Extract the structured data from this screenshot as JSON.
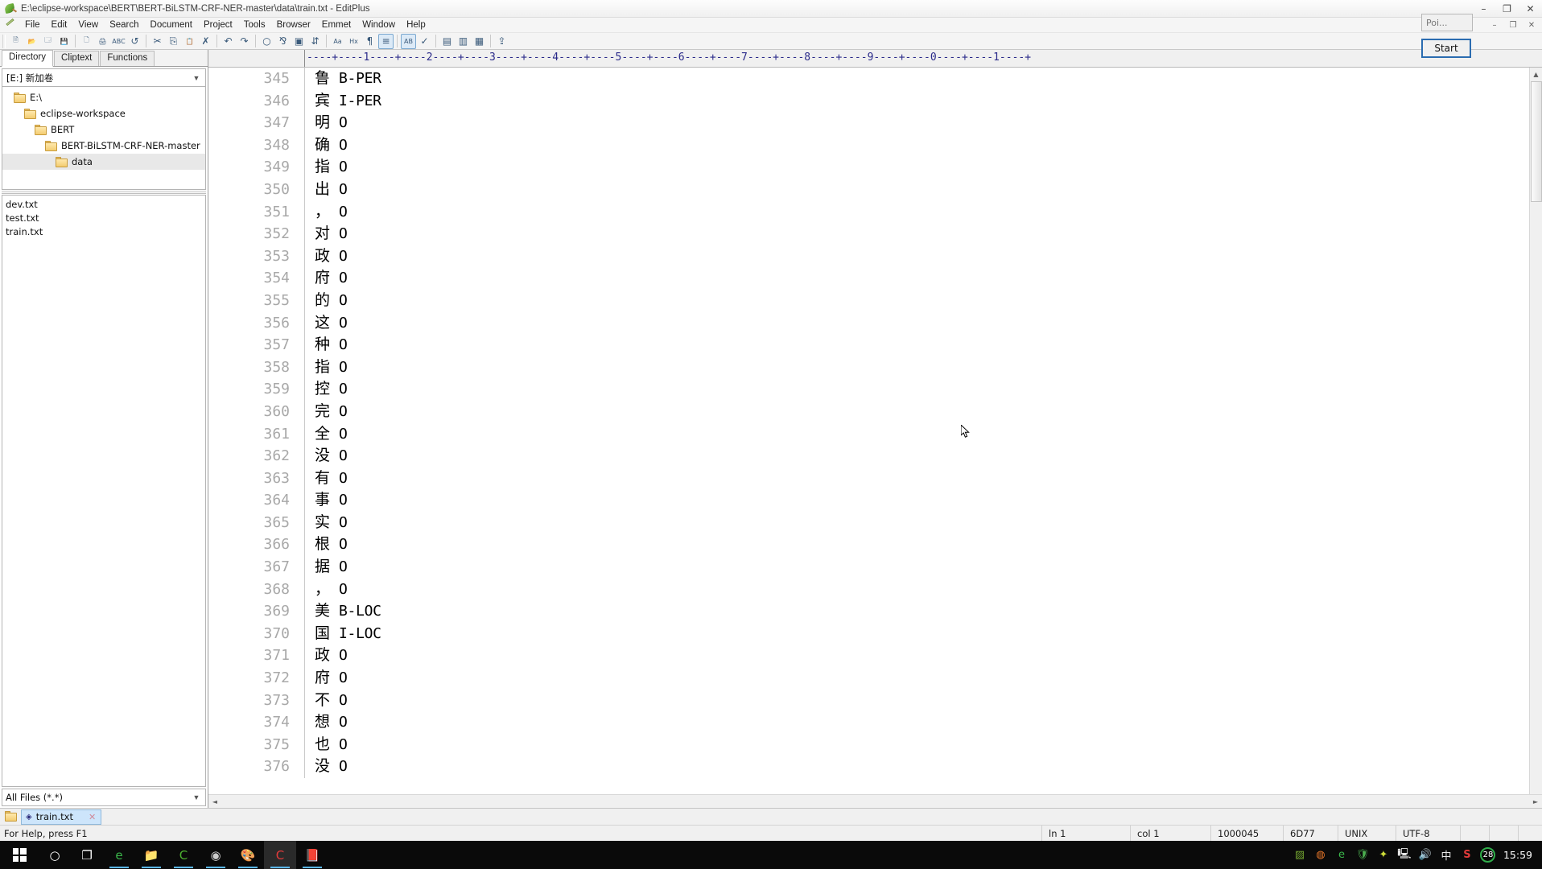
{
  "window": {
    "title": "E:\\eclipse-workspace\\BERT\\BERT-BiLSTM-CRF-NER-master\\data\\train.txt - EditPlus",
    "minimize": "–",
    "maximize": "❐",
    "close": "✕",
    "inner_minimize": "–",
    "inner_maximize": "❐",
    "inner_close": "✕"
  },
  "menu": {
    "items": [
      "File",
      "Edit",
      "View",
      "Search",
      "Document",
      "Project",
      "Tools",
      "Browser",
      "Emmet",
      "Window",
      "Help"
    ]
  },
  "toolbar": {
    "buttons": [
      {
        "name": "new-file",
        "glyph": "🗎"
      },
      {
        "name": "open-file",
        "glyph": "📂"
      },
      {
        "name": "close-file",
        "glyph": "🗔"
      },
      {
        "name": "save-file",
        "glyph": "💾"
      },
      {
        "name": "print-preview",
        "glyph": "🗋"
      },
      {
        "name": "print",
        "glyph": "🖨"
      },
      {
        "name": "spell-check",
        "glyph": "ABC"
      },
      {
        "name": "reload",
        "glyph": "↺"
      },
      {
        "name": "cut",
        "glyph": "✂"
      },
      {
        "name": "copy",
        "glyph": "⎘"
      },
      {
        "name": "paste",
        "glyph": "📋"
      },
      {
        "name": "delete",
        "glyph": "✗"
      },
      {
        "name": "undo",
        "glyph": "↶"
      },
      {
        "name": "redo",
        "glyph": "↷"
      },
      {
        "name": "find",
        "glyph": "○"
      },
      {
        "name": "replace",
        "glyph": "⅋"
      },
      {
        "name": "find-in-files",
        "glyph": "▣"
      },
      {
        "name": "goto-line",
        "glyph": "⇵"
      },
      {
        "name": "font-toggle",
        "glyph": "Aa"
      },
      {
        "name": "hex-view",
        "glyph": "Hx"
      },
      {
        "name": "word-wrap",
        "glyph": "¶"
      },
      {
        "name": "line-numbers",
        "glyph": "≡"
      },
      {
        "name": "toggle-case",
        "glyph": "AB"
      },
      {
        "name": "highlight",
        "glyph": "✓"
      },
      {
        "name": "browser-preview",
        "glyph": "▤"
      },
      {
        "name": "user-tool",
        "glyph": "▥"
      },
      {
        "name": "html-toolbar",
        "glyph": "▦"
      },
      {
        "name": "ftp-upload",
        "glyph": "⇪"
      }
    ]
  },
  "sidebar": {
    "tabs": [
      {
        "label": "Directory",
        "selected": true
      },
      {
        "label": "Cliptext",
        "selected": false
      },
      {
        "label": "Functions",
        "selected": false
      }
    ],
    "drive": "[E:] 新加卷",
    "tree": [
      {
        "label": "E:\\",
        "indent": 0,
        "selected": false
      },
      {
        "label": "eclipse-workspace",
        "indent": 1,
        "selected": false
      },
      {
        "label": "BERT",
        "indent": 2,
        "selected": false
      },
      {
        "label": "BERT-BiLSTM-CRF-NER-master",
        "indent": 3,
        "selected": false
      },
      {
        "label": "data",
        "indent": 4,
        "selected": true
      }
    ],
    "files": [
      "dev.txt",
      "test.txt",
      "train.txt"
    ],
    "filter": "All Files (*.*)"
  },
  "editor": {
    "ruler": "----+----1----+----2----+----3----+----4----+----5----+----6----+----7----+----8----+----9----+----0----+----1----+",
    "lines": [
      {
        "no": "345",
        "char": "鲁",
        "tag": "B-PER"
      },
      {
        "no": "346",
        "char": "宾",
        "tag": "I-PER"
      },
      {
        "no": "347",
        "char": "明",
        "tag": "O"
      },
      {
        "no": "348",
        "char": "确",
        "tag": "O"
      },
      {
        "no": "349",
        "char": "指",
        "tag": "O"
      },
      {
        "no": "350",
        "char": "出",
        "tag": "O"
      },
      {
        "no": "351",
        "char": "，",
        "tag": "O"
      },
      {
        "no": "352",
        "char": "对",
        "tag": "O"
      },
      {
        "no": "353",
        "char": "政",
        "tag": "O"
      },
      {
        "no": "354",
        "char": "府",
        "tag": "O"
      },
      {
        "no": "355",
        "char": "的",
        "tag": "O"
      },
      {
        "no": "356",
        "char": "这",
        "tag": "O"
      },
      {
        "no": "357",
        "char": "种",
        "tag": "O"
      },
      {
        "no": "358",
        "char": "指",
        "tag": "O"
      },
      {
        "no": "359",
        "char": "控",
        "tag": "O"
      },
      {
        "no": "360",
        "char": "完",
        "tag": "O"
      },
      {
        "no": "361",
        "char": "全",
        "tag": "O"
      },
      {
        "no": "362",
        "char": "没",
        "tag": "O"
      },
      {
        "no": "363",
        "char": "有",
        "tag": "O"
      },
      {
        "no": "364",
        "char": "事",
        "tag": "O"
      },
      {
        "no": "365",
        "char": "实",
        "tag": "O"
      },
      {
        "no": "366",
        "char": "根",
        "tag": "O"
      },
      {
        "no": "367",
        "char": "据",
        "tag": "O"
      },
      {
        "no": "368",
        "char": "，",
        "tag": "O"
      },
      {
        "no": "369",
        "char": "美",
        "tag": "B-LOC"
      },
      {
        "no": "370",
        "char": "国",
        "tag": "I-LOC"
      },
      {
        "no": "371",
        "char": "政",
        "tag": "O"
      },
      {
        "no": "372",
        "char": "府",
        "tag": "O"
      },
      {
        "no": "373",
        "char": "不",
        "tag": "O"
      },
      {
        "no": "374",
        "char": "想",
        "tag": "O"
      },
      {
        "no": "375",
        "char": "也",
        "tag": "O"
      },
      {
        "no": "376",
        "char": "没",
        "tag": "O"
      }
    ]
  },
  "doctab": {
    "marker": "◈",
    "label": "train.txt",
    "close": "✕"
  },
  "statusbar": {
    "help": "For Help, press F1",
    "line": "ln 1",
    "col": "col 1",
    "size": "1000045",
    "hex": "6D77",
    "eol": "UNIX",
    "encoding": "UTF-8"
  },
  "overlay": {
    "tooltip": "Poi...",
    "start_button": "Start"
  },
  "taskbar": {
    "clock": "15:59",
    "tray_ime": "中",
    "tray_badge": "28",
    "apps": [
      {
        "name": "cortana-search-icon",
        "glyph": "○"
      },
      {
        "name": "task-view-icon",
        "glyph": "❐"
      },
      {
        "name": "edge-browser-icon",
        "glyph": "e"
      },
      {
        "name": "file-explorer-icon",
        "glyph": "📁"
      },
      {
        "name": "wechat-icon",
        "glyph": "C"
      },
      {
        "name": "browser-icon",
        "glyph": "◉"
      },
      {
        "name": "paint-icon",
        "glyph": "🎨"
      },
      {
        "name": "editplus-icon",
        "glyph": "C"
      },
      {
        "name": "notepad-icon",
        "glyph": "📕"
      }
    ],
    "tray": [
      {
        "name": "nvidia-tray-icon",
        "glyph": "▨"
      },
      {
        "name": "app-tray-icon",
        "glyph": "◍"
      },
      {
        "name": "browser-tray-icon",
        "glyph": "e"
      },
      {
        "name": "security-shield-icon",
        "glyph": "🛡"
      },
      {
        "name": "update-tray-icon",
        "glyph": "✦"
      },
      {
        "name": "network-icon",
        "glyph": "🖳"
      },
      {
        "name": "volume-icon",
        "glyph": "🔊"
      }
    ]
  }
}
